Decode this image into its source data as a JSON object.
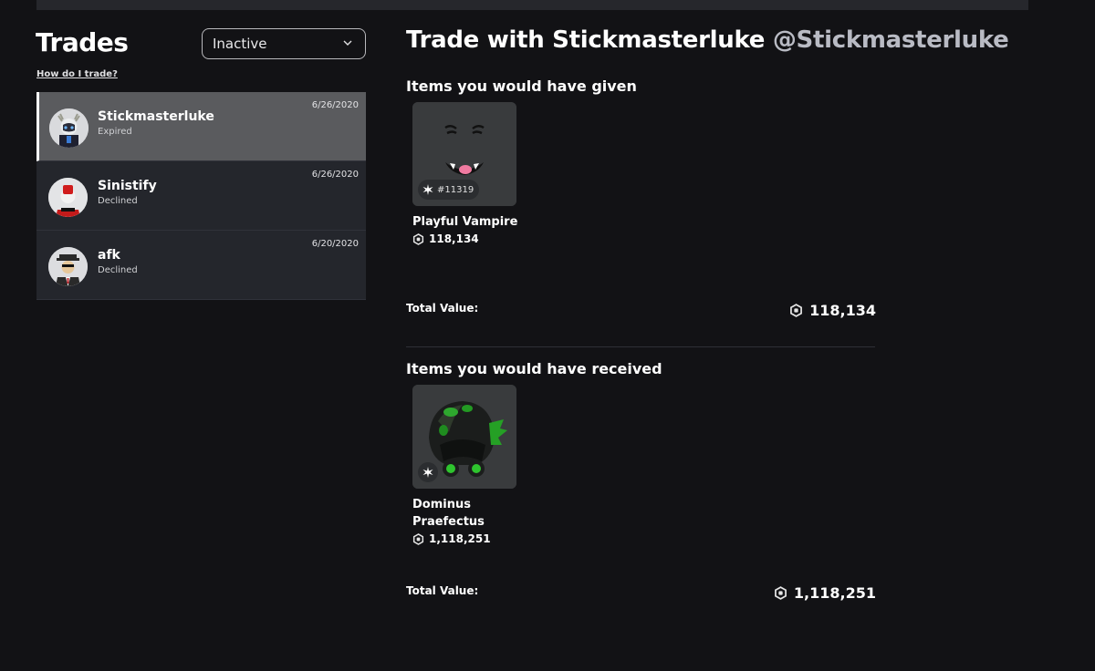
{
  "sidebar": {
    "title": "Trades",
    "filter_value": "Inactive",
    "help_link": "How do I trade?",
    "trades": [
      {
        "name": "Stickmasterluke",
        "status": "Expired",
        "date": "6/26/2020",
        "active": true
      },
      {
        "name": "Sinistify",
        "status": "Declined",
        "date": "6/26/2020",
        "active": false
      },
      {
        "name": "afk",
        "status": "Declined",
        "date": "6/20/2020",
        "active": false
      }
    ]
  },
  "trade": {
    "heading": "Trade with Stickmasterluke",
    "handle": "@Stickmasterluke",
    "given": {
      "title": "Items you would have given",
      "items": [
        {
          "name": "Playful Vampire",
          "price": "118,134",
          "serial": "#11319",
          "icon": "playful-vampire-face"
        }
      ],
      "total_label": "Total Value:",
      "total_value": "118,134"
    },
    "received": {
      "title": "Items you would have received",
      "items": [
        {
          "name": "Dominus Praefectus",
          "price": "1,118,251",
          "icon": "dominus-praefectus-hat"
        }
      ],
      "total_label": "Total Value:",
      "total_value": "1,118,251"
    }
  },
  "colors": {
    "background": "#121215",
    "row": "#24262c",
    "row_active": "#5a5b5e",
    "thumb": "#393b3d",
    "handle": "#b9bbc4"
  }
}
